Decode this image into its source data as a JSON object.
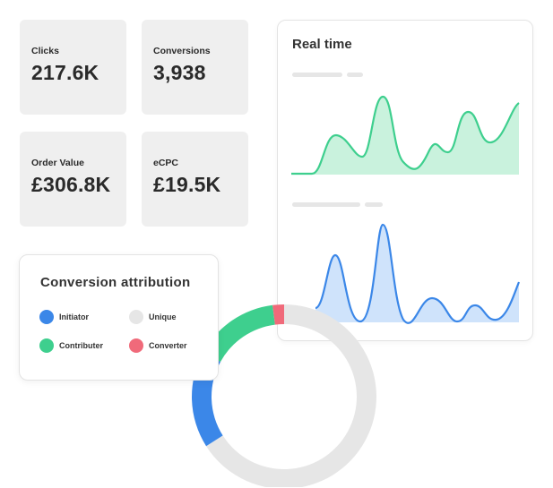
{
  "kpis": {
    "clicks": {
      "label": "Clicks",
      "value": "217.6K"
    },
    "conversions": {
      "label": "Conversions",
      "value": "3,938"
    },
    "order_value": {
      "label": "Order Value",
      "value": "£306.8K"
    },
    "ecpc": {
      "label": "eCPC",
      "value": "£19.5K"
    }
  },
  "realtime": {
    "title": "Real time",
    "colors": {
      "green_line": "#3ecf8e",
      "green_fill": "#c9f2dd",
      "blue_line": "#3b87e8",
      "blue_fill": "#cfe3fb",
      "placeholder": "#e6e6e6"
    }
  },
  "attribution": {
    "title": "Conversion attribution",
    "legend": [
      {
        "label": "Initiator",
        "color": "#3b87e8"
      },
      {
        "label": "Unique",
        "color": "#e6e6e6"
      },
      {
        "label": "Contributer",
        "color": "#3ecf8e"
      },
      {
        "label": "Converter",
        "color": "#f06a7a"
      }
    ]
  },
  "chart_data": {
    "type": "pie",
    "categories": [
      "Unique",
      "Initiator",
      "Contributer",
      "Converter"
    ],
    "values": [
      66,
      17,
      15,
      2
    ],
    "colors": [
      "#e6e6e6",
      "#3b87e8",
      "#3ecf8e",
      "#f06a7a"
    ],
    "donut": true
  }
}
